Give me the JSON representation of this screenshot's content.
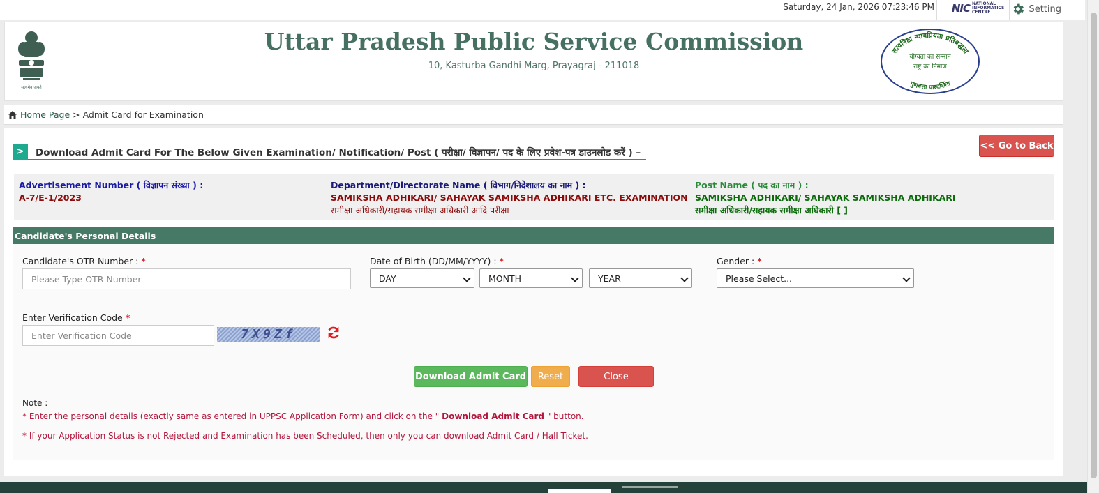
{
  "topbar": {
    "datetime": "Saturday, 24 Jan, 2026 07:23:46 PM",
    "nic_logo": "NIC",
    "nic_text": "NATIONAL INFORMATICS CENTRE",
    "setting_label": "Setting",
    "setting_icon": "gear-icon"
  },
  "header": {
    "title": "Uttar Pradesh Public Service Commission",
    "address": "10, Kasturba Gandhi Marg, Prayagraj - 211018",
    "emblem_caption": "सत्यमेव जयते",
    "seal_top": "सत्यनिष्ठा न्यायप्रियता प्रतिबद्धता",
    "seal_mid1": "योग्यता का सम्मान",
    "seal_mid2": "राष्ट्र का निर्माण",
    "seal_bottom": "गुणवत्ता पारदर्शिता"
  },
  "breadcrumb": {
    "home": "Home Page",
    "separator": " > ",
    "current": "Admit Card for Examination"
  },
  "main": {
    "title_chevron": ">",
    "title": "Download Admit Card For The Below Given Examination/ Notification/ Post ( परीक्षा/ विज्ञापन/ पद के लिए प्रवेश-पत्र डाउनलोड करें ) –",
    "back_button": "<< Go to Back"
  },
  "advertisement": {
    "adv_label": "Advertisement Number ( विज्ञापन संख्या ) :",
    "adv_value": "A-7/E-1/2023",
    "dept_label": "Department/Directorate Name ( विभाग/निदेशालय का नाम ) :",
    "dept_value1": "SAMIKSHA ADHIKARI/ SAHAYAK SAMIKSHA ADHIKARI ETC. EXAMINATION",
    "dept_value2": "समीक्षा अधिकारी/सहायक समीक्षा अधिकारी आदि परीक्षा",
    "post_label": "Post Name ( पद का नाम ) :",
    "post_value1": "SAMIKSHA ADHIKARI/ SAHAYAK SAMIKSHA ADHIKARI",
    "post_value2": "समीक्षा अधिकारी/सहायक समीक्षा अधिकारी [ ]"
  },
  "form": {
    "section_title": "Candidate's Personal Details",
    "required_mark": "*",
    "otr_label": "Candidate's OTR Number :",
    "otr_placeholder": "Please Type OTR Number",
    "dob_label": "Date of Birth (DD/MM/YYYY) :",
    "dob_day": "DAY",
    "dob_month": "MONTH",
    "dob_year": "YEAR",
    "gender_label": "Gender :",
    "gender_selected": "Please Select...",
    "verify_label": "Enter Verification Code",
    "verify_placeholder": "Enter Verification Code",
    "captcha_text": "7X9Zf",
    "refresh_icon": "refresh-icon",
    "download_button": "Download Admit Card",
    "reset_button": "Reset",
    "close_button": "Close"
  },
  "notes": {
    "title": "Note :",
    "note1_pre": "* Enter the personal details (exactly same as entered in UPPSC Application Form) and click on the \" ",
    "note1_bold": "Download Admit Card",
    "note1_post": " \" button.",
    "note2": "* If your Application Status is not Rejected and Examination has been Scheduled, then only you can download Admit Card / Hall Ticket."
  },
  "colors": {
    "brand_green": "#467061",
    "section_header": "#477a66",
    "danger": "#d9534f",
    "success": "#5cb85c",
    "warning": "#f0ad4e",
    "note_red": "#b3163c"
  }
}
